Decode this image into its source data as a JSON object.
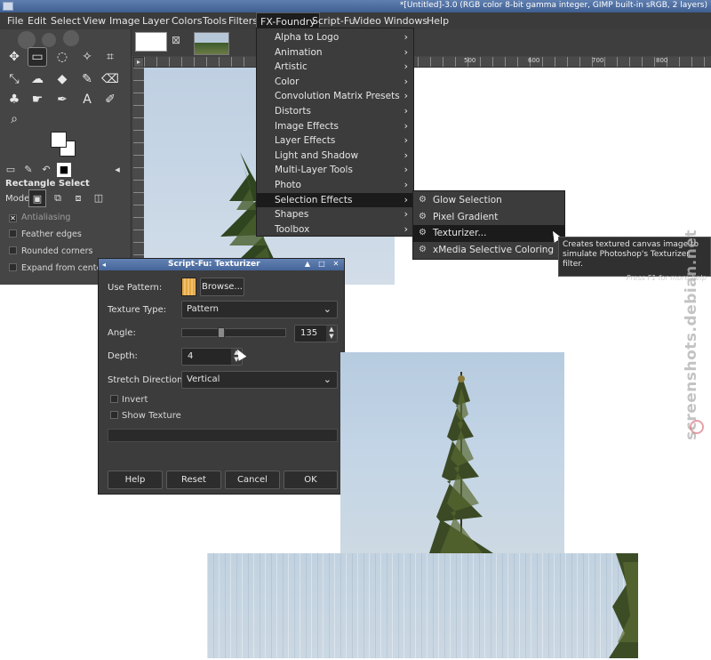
{
  "window": {
    "title": "*[Untitled]-3.0 (RGB color 8-bit gamma integer, GIMP built-in sRGB, 2 layers)"
  },
  "menubar": {
    "items": [
      "File",
      "Edit",
      "Select",
      "View",
      "Image",
      "Layer",
      "Colors",
      "Tools",
      "Filters",
      "FX-Foundry",
      "Script-Fu",
      "Video",
      "Windows",
      "Help"
    ],
    "active": "FX-Foundry"
  },
  "fx_menu": {
    "items": [
      "Alpha to Logo",
      "Animation",
      "Artistic",
      "Color",
      "Convolution Matrix Presets",
      "Distorts",
      "Image Effects",
      "Layer Effects",
      "Light and Shadow",
      "Multi-Layer Tools",
      "Photo",
      "Selection Effects",
      "Shapes",
      "Toolbox"
    ],
    "active": "Selection Effects"
  },
  "selection_effects_submenu": {
    "items": [
      "Glow Selection",
      "Pixel Gradient",
      "Texturizer...",
      "xMedia Selective Coloring"
    ],
    "active": "Texturizer..."
  },
  "tooltip": {
    "text": "Creates textured canvas image to simulate Photoshop's Texturizer filter.",
    "hint": "Press F1 for more help"
  },
  "tool_options": {
    "title": "Rectangle Select",
    "mode_label": "Mode:",
    "options": [
      "Antialiasing",
      "Feather edges",
      "Rounded corners",
      "Expand from center"
    ]
  },
  "ruler": {
    "marks": [
      "500",
      "600",
      "700",
      "800"
    ]
  },
  "dialog": {
    "title": "Script-Fu: Texturizer",
    "use_pattern_label": "Use Pattern:",
    "browse_label": "Browse...",
    "texture_type_label": "Texture Type:",
    "texture_type_value": "Pattern",
    "angle_label": "Angle:",
    "angle_value": "135",
    "depth_label": "Depth:",
    "depth_value": "4",
    "stretch_label": "Stretch Direction:",
    "stretch_value": "Vertical",
    "invert_label": "Invert",
    "show_texture_label": "Show Texture",
    "buttons": [
      "Help",
      "Reset",
      "Cancel",
      "OK"
    ]
  },
  "watermark": "screenshots.debian.net"
}
